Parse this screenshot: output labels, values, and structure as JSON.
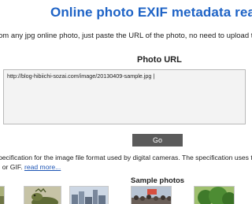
{
  "header": {
    "title": "Online photo EXIF metadata reader"
  },
  "intro": {
    "text": "om any jpg online photo, just paste the URL of the photo, no need to upload the"
  },
  "form": {
    "label": "Photo URL",
    "url_value": "http://blog-hibiichi-sozai.com/image/20130409-sample.jpg |",
    "go_label": "Go"
  },
  "description": {
    "line1": "pecification for the image file format used by digital cameras. The specification uses the existing",
    "line2_prefix": ", or GIF. ",
    "read_more": "read more..."
  },
  "samples": {
    "label": "Sample photos",
    "thumbs": [
      {
        "icon": "lizard-photo"
      },
      {
        "icon": "lizard-photo"
      },
      {
        "icon": "city-photo"
      },
      {
        "icon": "crowd-photo"
      },
      {
        "icon": "tree-photo"
      }
    ]
  }
}
